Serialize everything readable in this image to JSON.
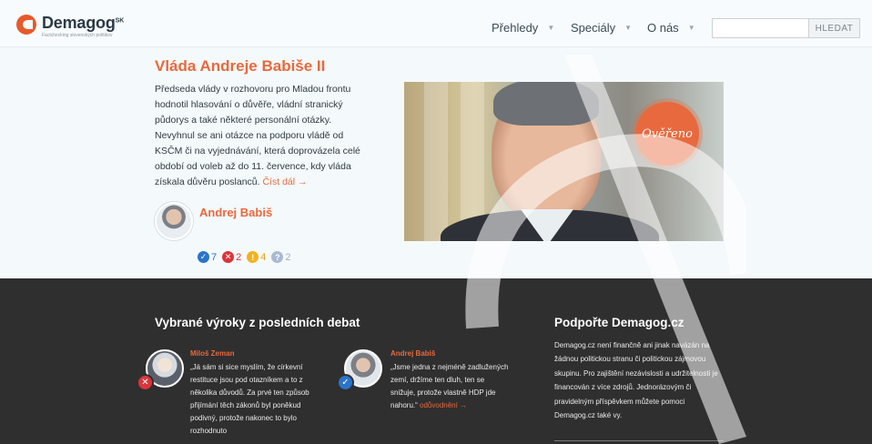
{
  "header": {
    "logo": {
      "name": "Demagog",
      "sup": "SK",
      "tagline": "Factchecking slovenských politikov"
    },
    "nav": [
      {
        "label": "Přehledy"
      },
      {
        "label": "Speciály"
      },
      {
        "label": "O nás"
      }
    ],
    "search": {
      "value": "",
      "placeholder": "",
      "button_label": "HLEDAT"
    }
  },
  "hero": {
    "title": "Vláda Andreje Babiše II",
    "text": "Předseda vlády v rozhovoru pro Mladou frontu hodnotil hlasování o důvěře, vládní stranický půdorys a také některé personální otázky. Nevyhnul se ani otázce na podporu vládě od KSČM či na vyjednávání, která doprovázela celé období od voleb až do 11. července, kdy vláda získala důvěru poslanců.",
    "read_more": "Číst dál →",
    "author": "Andrej Babiš",
    "badge": "Ověřeno",
    "stats": {
      "true": "7",
      "false": "2",
      "misleading": "4",
      "unverifiable": "2"
    }
  },
  "debates": {
    "title": "Vybrané výroky z posledních debat",
    "quotes": [
      {
        "author": "Miloš Zeman",
        "text": "„Já sám si sice myslím, že církevní restituce jsou pod otazníkem a to z několika důvodů. Za prvé ten způsob přijímání těch zákonů byl poněkud podivný, protože nakonec to bylo rozhodnuto",
        "verdict": "false"
      },
      {
        "author": "Andrej Babiš",
        "text": "„Jsme jedna z nejméně zadlužených zemí, držíme ten dluh, ten se snižuje, protože vlastně HDP jde nahoru.“",
        "link": "odůvodnění →",
        "verdict": "true"
      }
    ]
  },
  "support": {
    "title": "Podpořte Demagog.cz",
    "text": "Demagog.cz není finančně ani jinak navázán na žádnou politickou stranu či politickou zájmovou skupinu. Pro zajištění nezávislosti a udržitelnosti je financován z více zdrojů. Jednorázovým či pravidelným příspěvkem můžete pomoci Demagog.cz také vy."
  },
  "colors": {
    "accent": "#e8693d",
    "dark_bg": "#2f2f2f",
    "true": "#2a74c9",
    "false": "#d9363e",
    "misleading": "#f3b21b",
    "unverifiable": "#a9b9d3"
  }
}
